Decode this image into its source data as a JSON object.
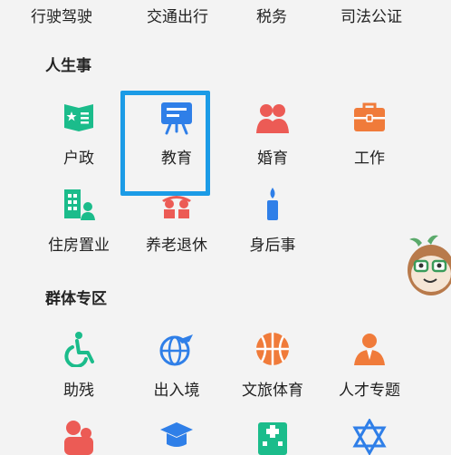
{
  "top_row": [
    "行驶驾驶",
    "交通出行",
    "税务",
    "司法公证"
  ],
  "life_events": {
    "title": "人生事",
    "items": [
      "户政",
      "教育",
      "婚育",
      "工作",
      "住房置业",
      "养老退休",
      "身后事"
    ]
  },
  "group_zone": {
    "title": "群体专区",
    "items": [
      "助残",
      "出入境",
      "文旅体育",
      "人才专题"
    ]
  },
  "colors": {
    "green": "#1bbc8b",
    "blue": "#2f7fe8",
    "red": "#ec5b55",
    "orange": "#f07b3a",
    "highlight": "#1b9be6"
  }
}
